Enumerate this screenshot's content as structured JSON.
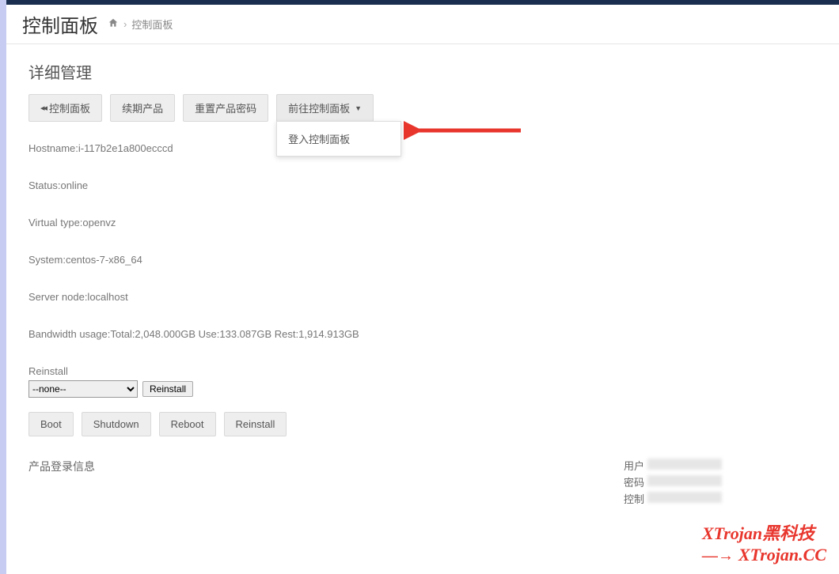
{
  "header": {
    "title": "控制面板",
    "breadcrumb_current": "控制面板"
  },
  "section_title": "详细管理",
  "buttons": {
    "back_label": "控制面板",
    "renew_label": "续期产品",
    "reset_pw_label": "重置产品密码",
    "goto_panel_label": "前往控制面板",
    "dropdown_login": "登入控制面板"
  },
  "info": {
    "hostname": "Hostname:i-117b2e1a800ecccd",
    "status": "Status:online",
    "virtual_type": "Virtual type:openvz",
    "system": "System:centos-7-x86_64",
    "server_node": "Server node:localhost",
    "bandwidth": "Bandwidth usage:Total:2,048.000GB Use:133.087GB Rest:1,914.913GB"
  },
  "reinstall": {
    "label": "Reinstall",
    "select_value": "--none--",
    "btn_label": "Reinstall"
  },
  "actions": {
    "boot": "Boot",
    "shutdown": "Shutdown",
    "reboot": "Reboot",
    "reinstall": "Reinstall"
  },
  "login_info": {
    "title": "产品登录信息",
    "user_label": "用户",
    "pass_label": "密码",
    "ctrl_label": "控制"
  },
  "watermark": {
    "line1": "XTrojan黑科技",
    "line2": "XTrojan.CC"
  }
}
